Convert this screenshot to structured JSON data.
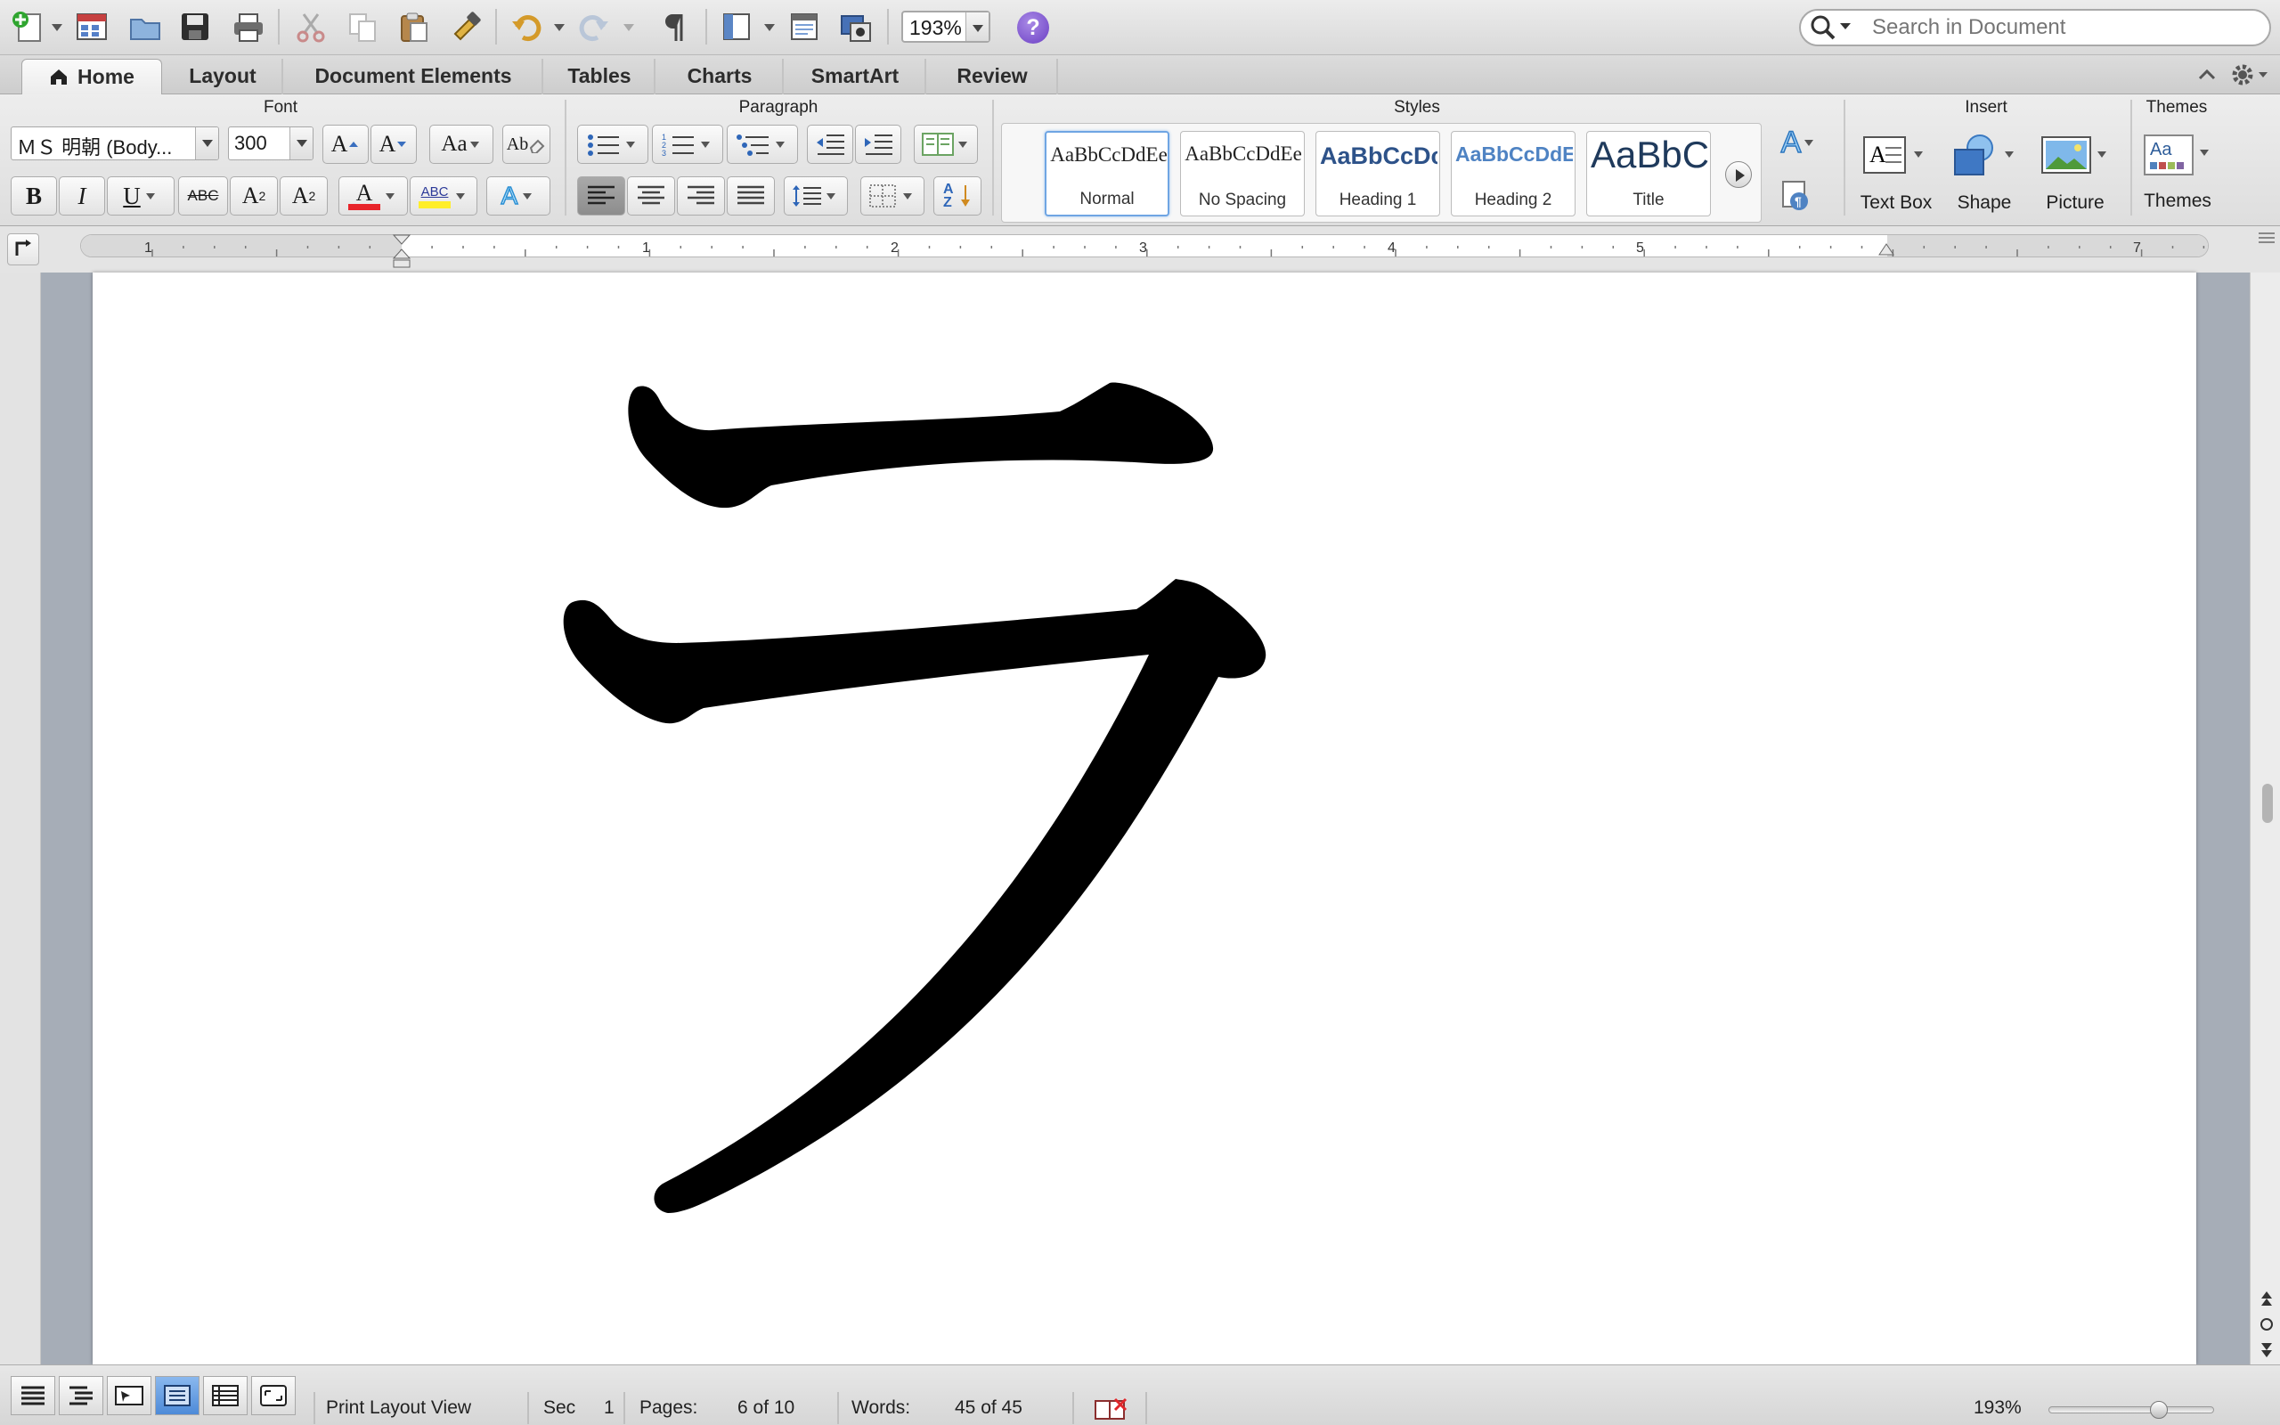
{
  "search": {
    "placeholder": "Search in Document"
  },
  "toolbar": {
    "zoom_value": "193%",
    "help_label": "?"
  },
  "tabs": [
    {
      "label": "Home"
    },
    {
      "label": "Layout"
    },
    {
      "label": "Document Elements"
    },
    {
      "label": "Tables"
    },
    {
      "label": "Charts"
    },
    {
      "label": "SmartArt"
    },
    {
      "label": "Review"
    }
  ],
  "ribbon": {
    "font": {
      "group_label": "Font",
      "font_name": "ＭＳ 明朝 (Body...",
      "font_size": "300",
      "grow_label": "A",
      "shrink_label": "A",
      "case_label": "Aa",
      "clear_label": "Ab",
      "bold_label": "B",
      "italic_label": "I",
      "underline_label": "U",
      "strike_label": "ABC",
      "superscript_label": "A",
      "superscript_mark": "2",
      "subscript_label": "A",
      "subscript_mark": "2",
      "font_color_label": "A",
      "highlight_label": "ABC",
      "text_effects_label": "A"
    },
    "paragraph": {
      "group_label": "Paragraph",
      "sort_label": "AZ"
    },
    "styles": {
      "group_label": "Styles",
      "items": [
        {
          "preview": "AaBbCcDdEe",
          "name": "Normal"
        },
        {
          "preview": "AaBbCcDdEe",
          "name": "No Spacing"
        },
        {
          "preview": "AaBbCcDc",
          "name": "Heading 1"
        },
        {
          "preview": "AaBbCcDdEe",
          "name": "Heading 2"
        },
        {
          "preview": "AaBbC",
          "name": "Title"
        }
      ],
      "manage_label": "A"
    },
    "insert": {
      "group_label": "Insert",
      "text_box_label": "Text Box",
      "shape_label": "Shape",
      "picture_label": "Picture"
    },
    "themes": {
      "group_label": "Themes",
      "themes_label": "Themes",
      "preview": "Aa"
    }
  },
  "ruler": {
    "marks": [
      "1",
      "1",
      "2",
      "3",
      "4",
      "5",
      "7"
    ]
  },
  "document": {
    "content": "ラ"
  },
  "status": {
    "view_label": "Print Layout View",
    "sec_label": "Sec",
    "sec_value": "1",
    "pages_label": "Pages:",
    "pages_value": "6 of 10",
    "words_label": "Words:",
    "words_value": "45 of 45",
    "zoom_value": "193%"
  },
  "colors": {
    "font_color": "#e8242a",
    "highlight": "#ffee2a",
    "help_purple": "#6b3fc4",
    "selection_blue": "#6fa5e3"
  }
}
